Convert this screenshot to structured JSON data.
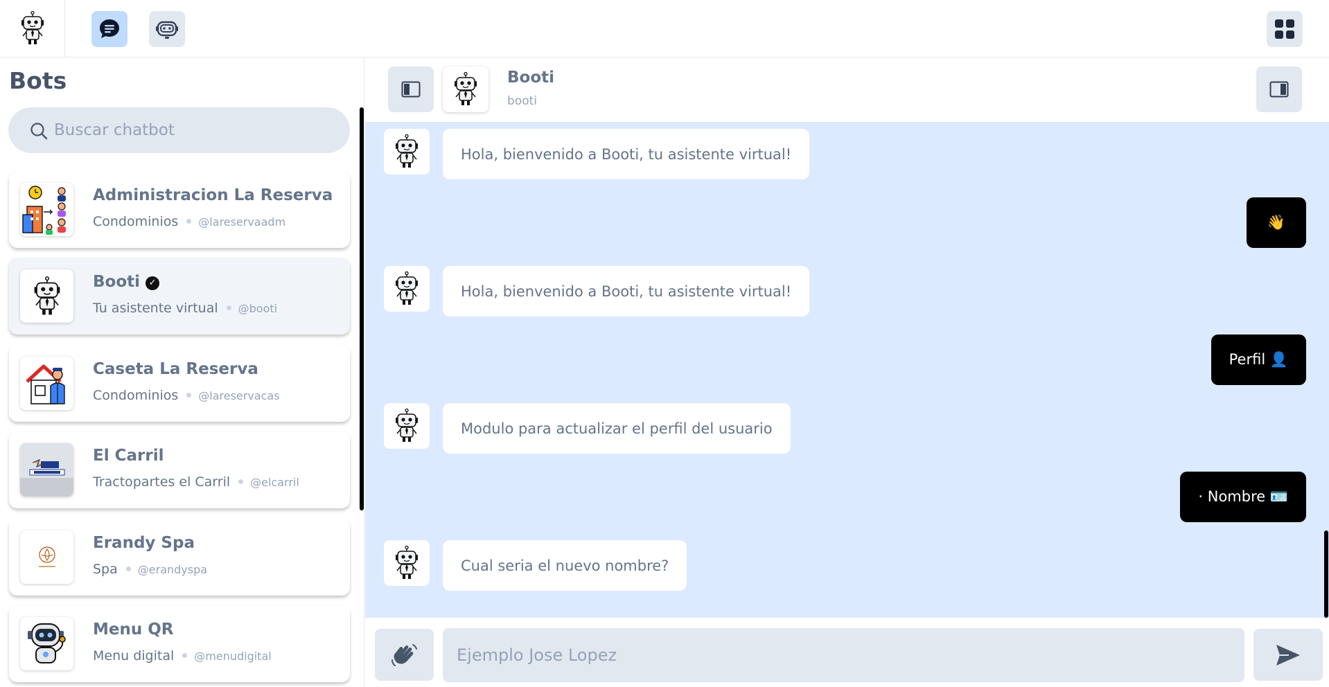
{
  "topbar": {
    "logo_icon": "robot-logo-icon",
    "nav": [
      {
        "icon": "chat-bubble-icon",
        "active": true
      },
      {
        "icon": "robot-face-icon",
        "active": false
      }
    ],
    "grid_icon": "grid-menu-icon"
  },
  "sidebar": {
    "title": "Bots",
    "search_placeholder": "Buscar chatbot",
    "bots": [
      {
        "name": "Administracion La Reserva",
        "category": "Condominios",
        "handle": "@lareservaadm",
        "verified": false,
        "active": false
      },
      {
        "name": "Booti",
        "category": "Tu asistente virtual",
        "handle": "@booti",
        "verified": true,
        "active": true
      },
      {
        "name": "Caseta La Reserva",
        "category": "Condominios",
        "handle": "@lareservacas",
        "verified": false,
        "active": false
      },
      {
        "name": "El Carril",
        "category": "Tractopartes el Carril",
        "handle": "@elcarril",
        "verified": false,
        "active": false
      },
      {
        "name": "Erandy Spa",
        "category": "Spa",
        "handle": "@erandyspa",
        "verified": false,
        "active": false
      },
      {
        "name": "Menu QR",
        "category": "Menu digital",
        "handle": "@menudigital",
        "verified": false,
        "active": false
      }
    ]
  },
  "chat": {
    "header": {
      "name": "Booti",
      "handle": "booti"
    },
    "messages": [
      {
        "from": "bot",
        "text": "Hola, bienvenido a Booti, tu asistente virtual!"
      },
      {
        "from": "user",
        "text": "👋"
      },
      {
        "from": "bot",
        "text": "Hola, bienvenido a Booti, tu asistente virtual!"
      },
      {
        "from": "user",
        "text": "Perfil 👤"
      },
      {
        "from": "bot",
        "text": "Modulo para actualizar el perfil del usuario"
      },
      {
        "from": "user",
        "text": "· Nombre 🪪"
      },
      {
        "from": "bot",
        "text": "Cual seria el nuevo nombre?"
      }
    ],
    "composer": {
      "placeholder": "Ejemplo Jose Lopez"
    }
  },
  "colors": {
    "accent_light": "#bfdbfe",
    "chat_background": "#dbeafe",
    "button_gray": "#e2e8f0",
    "user_bubble": "#000000"
  }
}
